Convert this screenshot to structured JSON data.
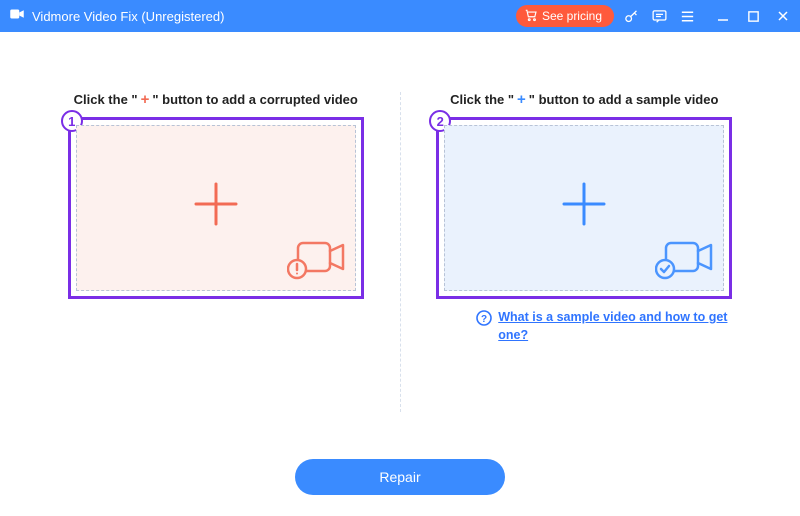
{
  "titlebar": {
    "title": "Vidmore Video Fix (Unregistered)",
    "see_pricing": "See pricing"
  },
  "left": {
    "instruction_pre": "Click the \"",
    "instruction_plus": "+",
    "instruction_post": "\" button to add a corrupted video",
    "step": "1"
  },
  "right": {
    "instruction_pre": "Click the \"",
    "instruction_plus": "+",
    "instruction_post": "\" button to add a sample video",
    "step": "2",
    "help_link": "What is a sample video and how to get one?"
  },
  "footer": {
    "repair": "Repair"
  }
}
